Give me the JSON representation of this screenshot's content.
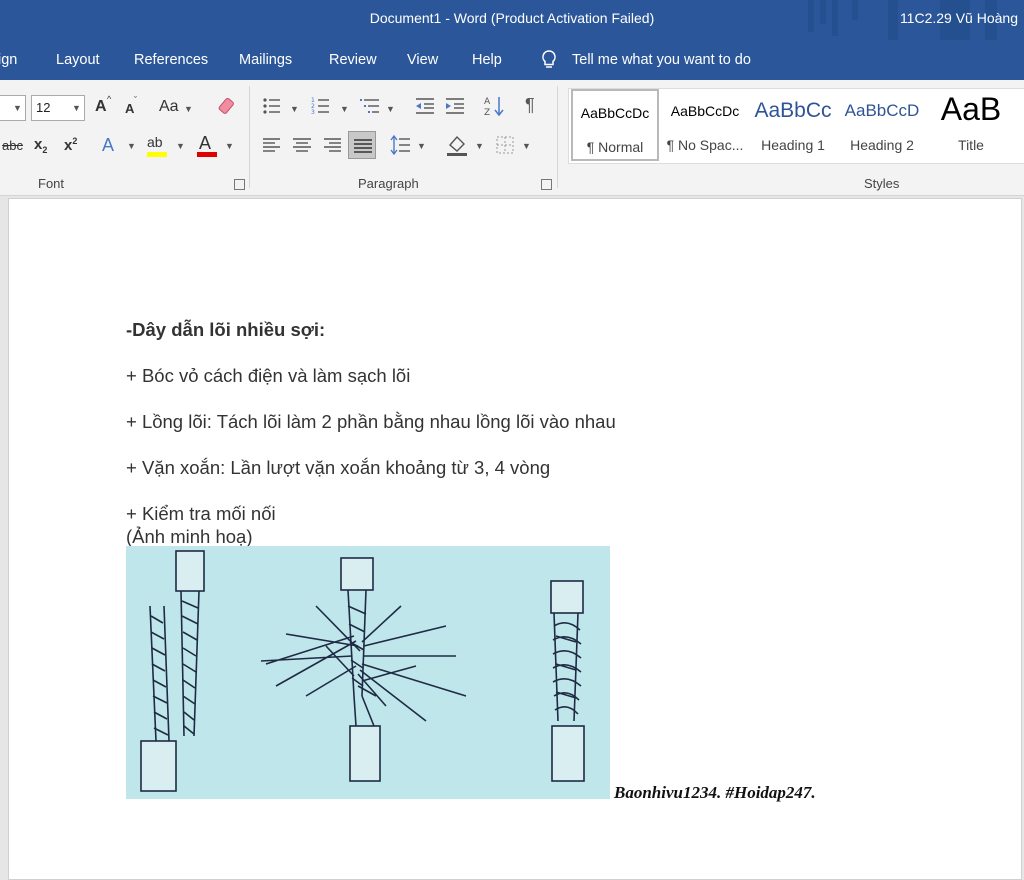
{
  "titlebar": {
    "title": "Document1  -  Word (Product Activation Failed)",
    "user": "11C2.29 Vũ Hoàng"
  },
  "tabs": [
    "ign",
    "Layout",
    "References",
    "Mailings",
    "Review",
    "View",
    "Help"
  ],
  "tell_me": "Tell me what you want to do",
  "ribbon": {
    "font": {
      "group_label": "Font",
      "size": "12",
      "grow": "A",
      "shrink": "A",
      "change_case": "Aa",
      "strikethrough": "abc",
      "subscript": "x",
      "subscript_mark": "2",
      "superscript": "x",
      "superscript_mark": "2",
      "text_effects": "A",
      "highlight": "ab",
      "font_color": "A"
    },
    "paragraph": {
      "group_label": "Paragraph",
      "pilcrow": "¶"
    },
    "styles": {
      "group_label": "Styles",
      "items": [
        {
          "sample": "AaBbCcDc",
          "name": "¶ Normal"
        },
        {
          "sample": "AaBbCcDc",
          "name": "¶ No Spac..."
        },
        {
          "sample": "AaBbCc",
          "name": "Heading 1"
        },
        {
          "sample": "AaBbCcD",
          "name": "Heading 2"
        },
        {
          "sample": "AaB",
          "name": "Title"
        }
      ]
    }
  },
  "document": {
    "heading": "-Dây dẫn lõi nhiều sợi:",
    "lines": [
      "+ Bóc vỏ cách điện và làm sạch lõi",
      "+ Lồng lõi: Tách lõi làm 2 phần bằng nhau lồng lõi vào nhau",
      "+ Vặn xoắn: Lần lượt vặn xoắn khoảng từ 3, 4 vòng",
      "+ Kiểm tra mối nối"
    ],
    "caption": "(Ảnh minh hoạ)",
    "watermark": "Baonhivu1234. #Hoidap247."
  },
  "colors": {
    "word_blue": "#2b579a",
    "ribbon_bg": "#f3f3f3",
    "figure_bg": "#bfe6ea",
    "highlight_yellow": "#ffff00",
    "font_red": "#e00000"
  },
  "icons": [
    "lightbulb-icon",
    "eraser-icon",
    "bullets-icon",
    "numbering-icon",
    "multilevel-list-icon",
    "decrease-indent-icon",
    "increase-indent-icon",
    "sort-icon",
    "align-left-icon",
    "center-icon",
    "align-right-icon",
    "justify-icon",
    "line-spacing-icon",
    "shading-icon",
    "borders-icon",
    "dialog-launcher-icon"
  ]
}
